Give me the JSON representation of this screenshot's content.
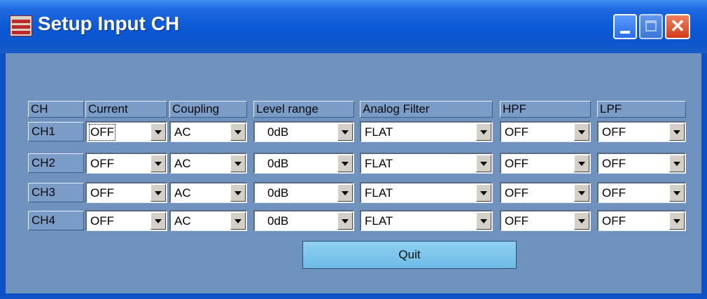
{
  "window": {
    "title": "Setup Input CH"
  },
  "table": {
    "headers": [
      "CH",
      "Current",
      "Coupling",
      "Level range",
      "Analog Filter",
      "HPF",
      "LPF"
    ],
    "rows": [
      {
        "ch": "CH1",
        "current": "OFF",
        "coupling": "AC",
        "level_range": "0dB",
        "analog_filter": "FLAT",
        "hpf": "OFF",
        "lpf": "OFF"
      },
      {
        "ch": "CH2",
        "current": "OFF",
        "coupling": "AC",
        "level_range": "0dB",
        "analog_filter": "FLAT",
        "hpf": "OFF",
        "lpf": "OFF"
      },
      {
        "ch": "CH3",
        "current": "OFF",
        "coupling": "AC",
        "level_range": "0dB",
        "analog_filter": "FLAT",
        "hpf": "OFF",
        "lpf": "OFF"
      },
      {
        "ch": "CH4",
        "current": "OFF",
        "coupling": "AC",
        "level_range": "0dB",
        "analog_filter": "FLAT",
        "hpf": "OFF",
        "lpf": "OFF"
      }
    ]
  },
  "buttons": {
    "quit_label": "Quit"
  },
  "colors": {
    "client_bg": "#7092be",
    "titlebar": "#0a58d6",
    "quit_bg": "#7ac4ec"
  }
}
